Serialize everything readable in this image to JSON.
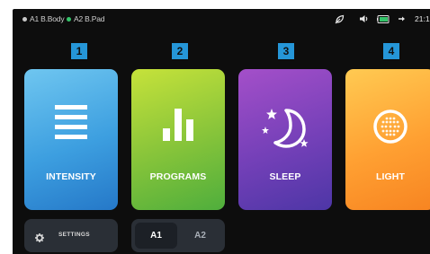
{
  "status": {
    "devices": [
      {
        "label": "A1 B.Body",
        "color": "#c9c9c9"
      },
      {
        "label": "A2 B.Pad",
        "color": "#35c46a"
      }
    ],
    "icons": [
      "leaf-icon",
      "volume-icon",
      "battery-icon",
      "bluetooth-icon"
    ],
    "battery_color": "#35c46a",
    "time": "21:1"
  },
  "tiles": [
    {
      "number": "1",
      "label": "INTENSITY",
      "icon": "bars-icon"
    },
    {
      "number": "2",
      "label": "PROGRAMS",
      "icon": "chart-icon"
    },
    {
      "number": "3",
      "label": "SLEEP",
      "icon": "moon-stars-icon"
    },
    {
      "number": "4",
      "label": "LIGHT",
      "icon": "light-dots-icon"
    }
  ],
  "settings": {
    "label": "SETTINGS"
  },
  "selector": {
    "options": [
      "A1",
      "A2"
    ],
    "selected": "A1"
  },
  "colors": {
    "badge": "#2596d8",
    "background": "#0d0d0d",
    "button": "#2a2f36"
  }
}
